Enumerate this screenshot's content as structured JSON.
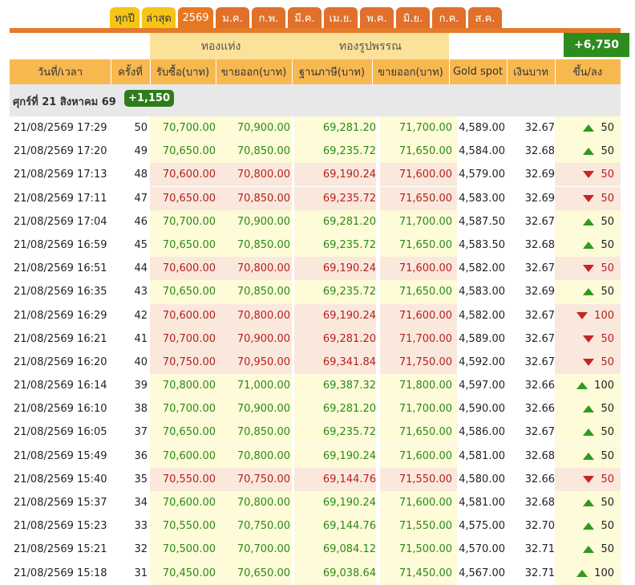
{
  "tabs": [
    "ทุกปี",
    "ล่าสุด",
    "2569",
    "ม.ค.",
    "ก.พ.",
    "มี.ค.",
    "เม.ย.",
    "พ.ค.",
    "มิ.ย.",
    "ก.ค.",
    "ส.ค."
  ],
  "header": {
    "gold_bar": "ทองแท่ง",
    "gold_jewelry": "ทองรูปพรรณ",
    "total_change": "+6,750",
    "col_datetime": "วันที่/เวลา",
    "col_round": "ครั้งที่",
    "col_bar_buy": "รับซื้อ(บาท)",
    "col_bar_sell": "ขายออก(บาท)",
    "col_jew_base": "ฐานภาษี(บาท)",
    "col_jew_sell": "ขายออก(บาท)",
    "col_gold_spot": "Gold spot",
    "col_thb": "เงินบาท",
    "col_change": "ขึ้น/ลง"
  },
  "day": {
    "label": "ศุกร์ที่ 21 สิงหาคม 69",
    "change": "+1,150"
  },
  "colors": {
    "up": "#2a8a1a",
    "down": "#b52020",
    "header": "#f7b850",
    "accent": "#e57a2a"
  },
  "rows": [
    {
      "dt": "21/08/2569 17:29",
      "n": "50",
      "b1": "70,700.00",
      "s1": "70,900.00",
      "b2": "69,281.20",
      "s2": "71,700.00",
      "gs": "4,589.00",
      "thb": "32.67",
      "dir": "up",
      "ch": "50"
    },
    {
      "dt": "21/08/2569 17:20",
      "n": "49",
      "b1": "70,650.00",
      "s1": "70,850.00",
      "b2": "69,235.72",
      "s2": "71,650.00",
      "gs": "4,584.00",
      "thb": "32.68",
      "dir": "up",
      "ch": "50"
    },
    {
      "dt": "21/08/2569 17:13",
      "n": "48",
      "b1": "70,600.00",
      "s1": "70,800.00",
      "b2": "69,190.24",
      "s2": "71,600.00",
      "gs": "4,579.00",
      "thb": "32.69",
      "dir": "down",
      "ch": "50"
    },
    {
      "dt": "21/08/2569 17:11",
      "n": "47",
      "b1": "70,650.00",
      "s1": "70,850.00",
      "b2": "69,235.72",
      "s2": "71,650.00",
      "gs": "4,583.00",
      "thb": "32.69",
      "dir": "down",
      "ch": "50"
    },
    {
      "dt": "21/08/2569 17:04",
      "n": "46",
      "b1": "70,700.00",
      "s1": "70,900.00",
      "b2": "69,281.20",
      "s2": "71,700.00",
      "gs": "4,587.50",
      "thb": "32.67",
      "dir": "up",
      "ch": "50"
    },
    {
      "dt": "21/08/2569 16:59",
      "n": "45",
      "b1": "70,650.00",
      "s1": "70,850.00",
      "b2": "69,235.72",
      "s2": "71,650.00",
      "gs": "4,583.50",
      "thb": "32.68",
      "dir": "up",
      "ch": "50"
    },
    {
      "dt": "21/08/2569 16:51",
      "n": "44",
      "b1": "70,600.00",
      "s1": "70,800.00",
      "b2": "69,190.24",
      "s2": "71,600.00",
      "gs": "4,582.00",
      "thb": "32.67",
      "dir": "down",
      "ch": "50"
    },
    {
      "dt": "21/08/2569 16:35",
      "n": "43",
      "b1": "70,650.00",
      "s1": "70,850.00",
      "b2": "69,235.72",
      "s2": "71,650.00",
      "gs": "4,583.00",
      "thb": "32.69",
      "dir": "up",
      "ch": "50"
    },
    {
      "dt": "21/08/2569 16:29",
      "n": "42",
      "b1": "70,600.00",
      "s1": "70,800.00",
      "b2": "69,190.24",
      "s2": "71,600.00",
      "gs": "4,582.00",
      "thb": "32.67",
      "dir": "down",
      "ch": "100"
    },
    {
      "dt": "21/08/2569 16:21",
      "n": "41",
      "b1": "70,700.00",
      "s1": "70,900.00",
      "b2": "69,281.20",
      "s2": "71,700.00",
      "gs": "4,589.00",
      "thb": "32.67",
      "dir": "down",
      "ch": "50"
    },
    {
      "dt": "21/08/2569 16:20",
      "n": "40",
      "b1": "70,750.00",
      "s1": "70,950.00",
      "b2": "69,341.84",
      "s2": "71,750.00",
      "gs": "4,592.00",
      "thb": "32.67",
      "dir": "down",
      "ch": "50"
    },
    {
      "dt": "21/08/2569 16:14",
      "n": "39",
      "b1": "70,800.00",
      "s1": "71,000.00",
      "b2": "69,387.32",
      "s2": "71,800.00",
      "gs": "4,597.00",
      "thb": "32.66",
      "dir": "up",
      "ch": "100"
    },
    {
      "dt": "21/08/2569 16:10",
      "n": "38",
      "b1": "70,700.00",
      "s1": "70,900.00",
      "b2": "69,281.20",
      "s2": "71,700.00",
      "gs": "4,590.00",
      "thb": "32.66",
      "dir": "up",
      "ch": "50"
    },
    {
      "dt": "21/08/2569 16:05",
      "n": "37",
      "b1": "70,650.00",
      "s1": "70,850.00",
      "b2": "69,235.72",
      "s2": "71,650.00",
      "gs": "4,586.00",
      "thb": "32.67",
      "dir": "up",
      "ch": "50"
    },
    {
      "dt": "21/08/2569 15:49",
      "n": "36",
      "b1": "70,600.00",
      "s1": "70,800.00",
      "b2": "69,190.24",
      "s2": "71,600.00",
      "gs": "4,581.00",
      "thb": "32.68",
      "dir": "up",
      "ch": "50"
    },
    {
      "dt": "21/08/2569 15:40",
      "n": "35",
      "b1": "70,550.00",
      "s1": "70,750.00",
      "b2": "69,144.76",
      "s2": "71,550.00",
      "gs": "4,580.00",
      "thb": "32.66",
      "dir": "down",
      "ch": "50"
    },
    {
      "dt": "21/08/2569 15:37",
      "n": "34",
      "b1": "70,600.00",
      "s1": "70,800.00",
      "b2": "69,190.24",
      "s2": "71,600.00",
      "gs": "4,581.00",
      "thb": "32.68",
      "dir": "up",
      "ch": "50"
    },
    {
      "dt": "21/08/2569 15:23",
      "n": "33",
      "b1": "70,550.00",
      "s1": "70,750.00",
      "b2": "69,144.76",
      "s2": "71,550.00",
      "gs": "4,575.00",
      "thb": "32.70",
      "dir": "up",
      "ch": "50"
    },
    {
      "dt": "21/08/2569 15:21",
      "n": "32",
      "b1": "70,500.00",
      "s1": "70,700.00",
      "b2": "69,084.12",
      "s2": "71,500.00",
      "gs": "4,570.00",
      "thb": "32.71",
      "dir": "up",
      "ch": "50"
    },
    {
      "dt": "21/08/2569 15:18",
      "n": "31",
      "b1": "70,450.00",
      "s1": "70,650.00",
      "b2": "69,038.64",
      "s2": "71,450.00",
      "gs": "4,567.00",
      "thb": "32.71",
      "dir": "up",
      "ch": "100"
    }
  ]
}
